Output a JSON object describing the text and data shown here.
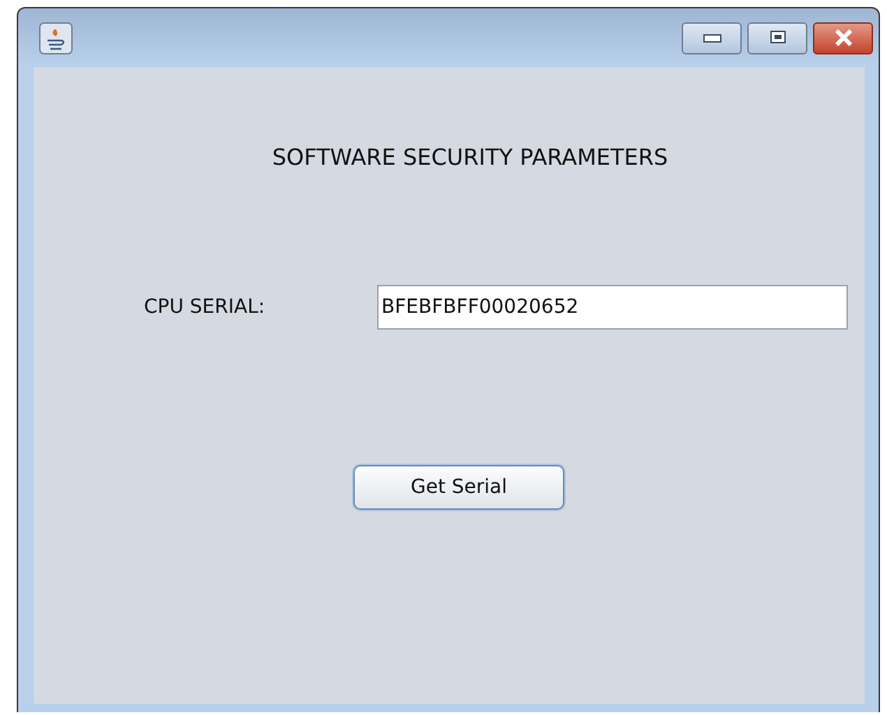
{
  "heading": "SOFTWARE SECURITY PARAMETERS",
  "field": {
    "label": "CPU SERIAL:",
    "value": "BFEBFBFF00020652"
  },
  "button": "Get Serial"
}
